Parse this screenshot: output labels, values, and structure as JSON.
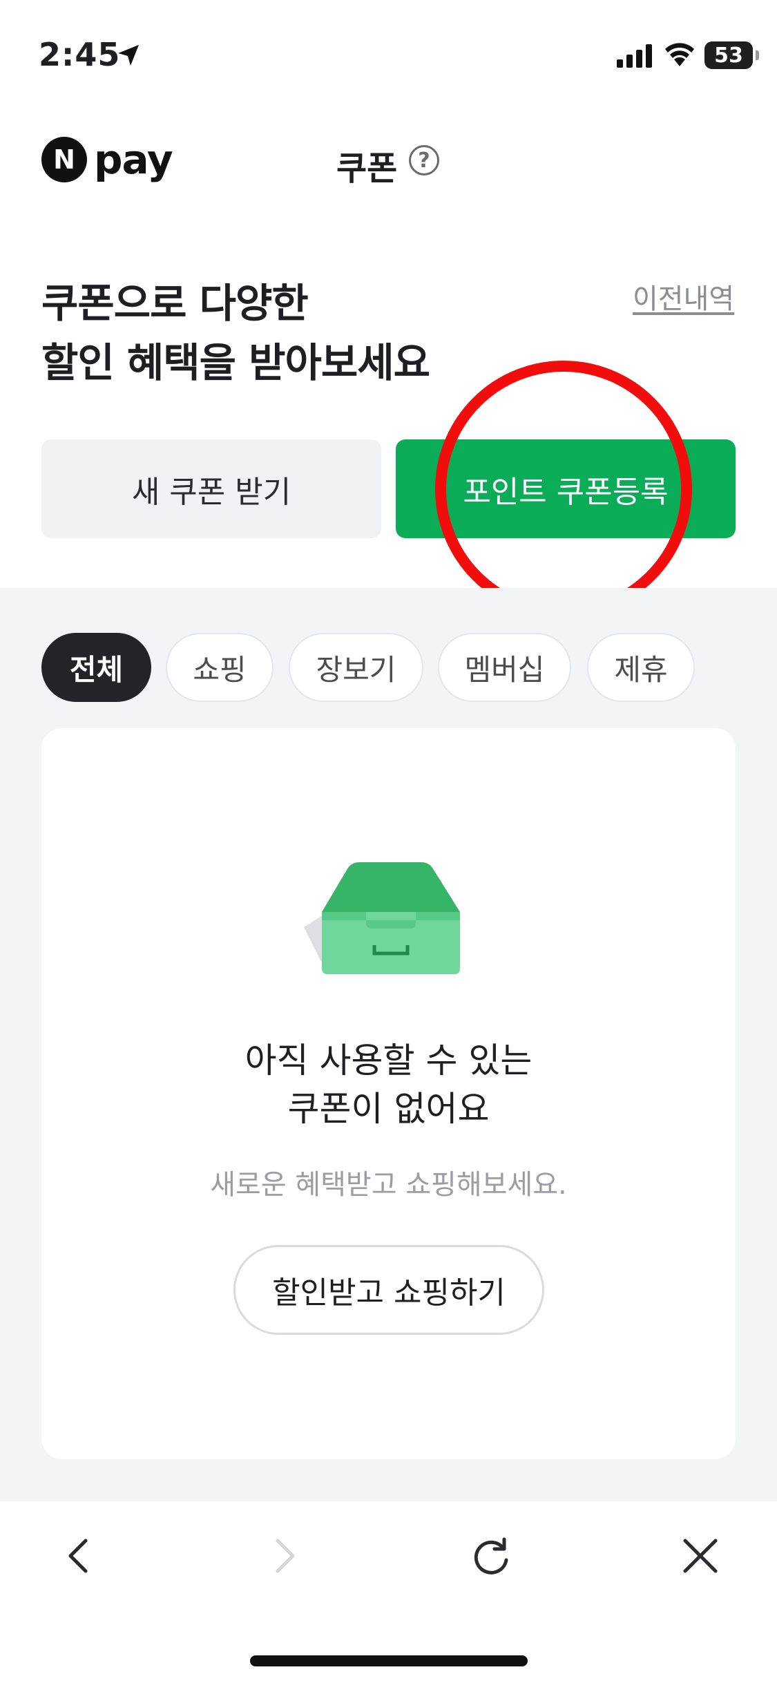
{
  "status_bar": {
    "time": "2:45",
    "battery": "53"
  },
  "header": {
    "logo_letter": "N",
    "logo_text": "pay",
    "title": "쿠폰",
    "help_symbol": "?"
  },
  "hero": {
    "title_line1": "쿠폰으로 다양한",
    "title_line2": "할인 혜택을 받아보세요",
    "history_link": "이전내역"
  },
  "buttons": {
    "new_coupon": "새 쿠폰 받기",
    "register_point_coupon": "포인트 쿠폰등록"
  },
  "filters": [
    {
      "label": "전체",
      "active": true
    },
    {
      "label": "쇼핑",
      "active": false
    },
    {
      "label": "장보기",
      "active": false
    },
    {
      "label": "멤버십",
      "active": false
    },
    {
      "label": "제휴",
      "active": false
    }
  ],
  "empty_state": {
    "title_line1": "아직 사용할 수 있는",
    "title_line2": "쿠폰이 없어요",
    "subtitle": "새로운 혜택받고 쇼핑해보세요.",
    "cta": "할인받고 쇼핑하기"
  },
  "bottom_nav": {
    "icons": [
      "back-icon",
      "forward-icon",
      "refresh-icon",
      "close-icon"
    ]
  },
  "colors": {
    "brand_green": "#0bac57",
    "highlight_red": "#f20d0d",
    "chip_active": "#222428"
  }
}
